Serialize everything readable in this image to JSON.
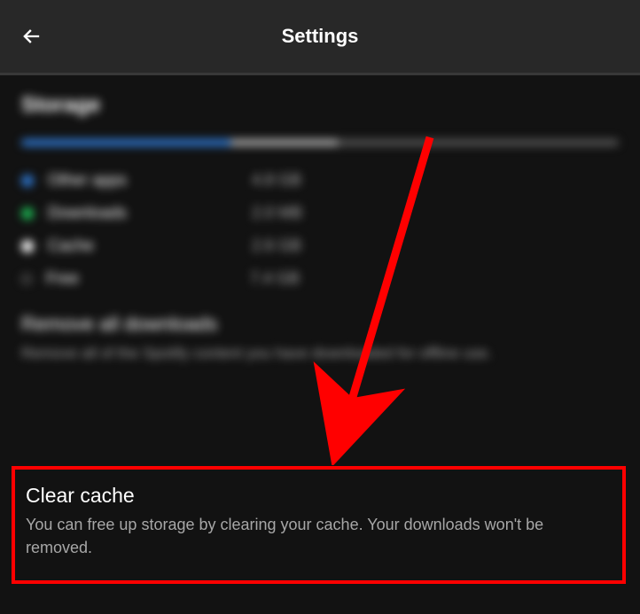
{
  "header": {
    "title": "Settings"
  },
  "storage": {
    "section_title": "Storage",
    "legend": [
      {
        "label": "Other apps",
        "value": "4.8 GB",
        "color": "blue"
      },
      {
        "label": "Downloads",
        "value": "2.0 MB",
        "color": "green"
      },
      {
        "label": "Cache",
        "value": "2.6 GB",
        "color": "white"
      },
      {
        "label": "Free",
        "value": "7.4 GB",
        "color": "gray"
      }
    ]
  },
  "remove_downloads": {
    "title": "Remove all downloads",
    "description": "Remove all of the Spotify content you have downloaded for offline use."
  },
  "clear_cache": {
    "title": "Clear cache",
    "description": "You can free up storage by clearing your cache. Your downloads won't be removed."
  },
  "annotation": {
    "color": "#ff0000"
  }
}
